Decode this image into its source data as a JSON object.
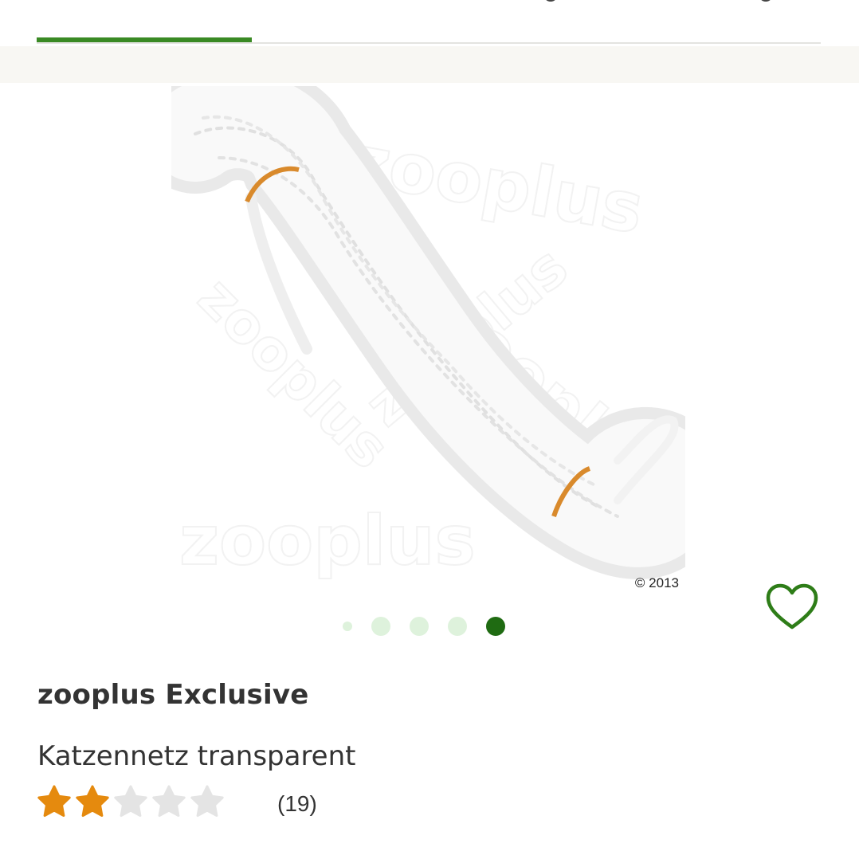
{
  "tabs": {
    "active_index": 0
  },
  "product_image": {
    "copyright": "© 2013",
    "watermark": "zooplus"
  },
  "gallery": {
    "slide_count": 5,
    "active_slide": 5
  },
  "wishlist": {
    "icon": "heart-outline-icon"
  },
  "product": {
    "brand": "zooplus Exclusive",
    "title": "Katzennetz transparent",
    "rating": {
      "value": 2,
      "max": 5,
      "count_label": "(19)"
    }
  },
  "colors": {
    "accent_green": "#3a8a24",
    "dot_active": "#1f6b12",
    "dot_inactive": "#def2dc",
    "star_filled": "#e58a0e",
    "star_empty": "#e4e4e4",
    "heart": "#2e7d18",
    "band": "#f8f7f3"
  }
}
